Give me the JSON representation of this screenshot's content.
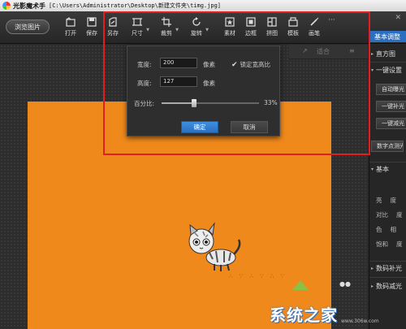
{
  "titlebar": {
    "app_name": "光影魔术手",
    "file_path": "[C:\\Users\\Administrator\\Desktop\\新建文件夹\\timg.jpg]"
  },
  "toolbar": {
    "browse_label": "浏览图片",
    "tools": [
      {
        "label": "打开",
        "icon": "open-icon"
      },
      {
        "label": "保存",
        "icon": "save-icon"
      },
      {
        "label": "另存",
        "icon": "save-as-icon"
      },
      {
        "label": "尺寸",
        "icon": "resize-icon"
      },
      {
        "label": "裁剪",
        "icon": "crop-icon"
      },
      {
        "label": "旋转",
        "icon": "rotate-icon"
      },
      {
        "label": "素材",
        "icon": "material-icon"
      },
      {
        "label": "边框",
        "icon": "border-icon"
      },
      {
        "label": "拼图",
        "icon": "collage-icon"
      },
      {
        "label": "模板",
        "icon": "template-icon"
      },
      {
        "label": "画笔",
        "icon": "brush-icon"
      }
    ],
    "more": "···"
  },
  "side_tabs": {
    "basic_tab": "基本调整",
    "close": "✕"
  },
  "subbar": {
    "arrow": "↗",
    "label": "适合",
    "menu": "≡"
  },
  "resize_dialog": {
    "width_label": "宽度:",
    "width_value": "200",
    "width_unit": "像素",
    "height_label": "高度:",
    "height_value": "127",
    "height_unit": "像素",
    "lock_label": "锁定宽高比",
    "lock_checked": true,
    "percent_label": "百分比:",
    "percent_value": "33%",
    "percent": 33,
    "ok_label": "确定",
    "cancel_label": "取消"
  },
  "right_panel": {
    "histogram": "直方图",
    "one_click": "一键设置",
    "auto_btn": "自动曝光",
    "one_btn_1": "一键补光",
    "one_btn_2": "一键减光",
    "digital_btn": "数字点测光",
    "basic": "基本",
    "rows": [
      {
        "a": "亮",
        "b": "度"
      },
      {
        "a": "对比",
        "b": "度"
      },
      {
        "a": "色",
        "b": "相"
      },
      {
        "a": "饱和",
        "b": "度"
      }
    ],
    "fill_light": "数码补光",
    "reduce_light": "数码减光"
  },
  "watermark": {
    "text": "系统之家",
    "url": "www.306w.com"
  },
  "colors": {
    "accent": "#2a6fc0",
    "image_bg": "#f0891c",
    "highlight": "#e0201e"
  }
}
